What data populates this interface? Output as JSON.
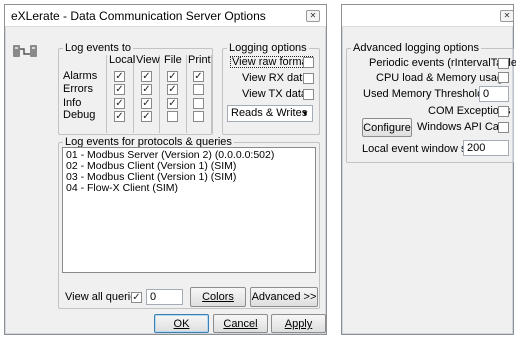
{
  "dialog": {
    "title": "eXLerate - Data Communication Server Options",
    "close_glyph": "✕"
  },
  "log_events_to": {
    "legend": "Log events to",
    "columns": [
      "Local",
      "View",
      "File",
      "Print"
    ],
    "rows": [
      {
        "label": "Alarms",
        "checks": [
          true,
          true,
          true,
          true
        ]
      },
      {
        "label": "Errors",
        "checks": [
          true,
          true,
          true,
          false
        ]
      },
      {
        "label": "Info",
        "checks": [
          true,
          true,
          true,
          false
        ]
      },
      {
        "label": "Debug",
        "checks": [
          true,
          true,
          false,
          false
        ]
      }
    ]
  },
  "logging_options": {
    "legend": "Logging options",
    "view_raw_format": {
      "label": "View raw format",
      "checked": false
    },
    "view_rx_data": {
      "label": "View RX data",
      "checked": false
    },
    "view_tx_data": {
      "label": "View TX data",
      "checked": false
    },
    "mode_select": {
      "value": "Reads & Writes"
    }
  },
  "protocols": {
    "legend": "Log events for protocols & queries",
    "items": [
      "01 - Modbus Server (Version 2) (0.0.0.0:502)",
      "02 - Modbus Client (Version 1) (SIM)",
      "03 - Modbus Client (Version 1) (SIM)",
      "04 - Flow-X Client (SIM)"
    ]
  },
  "footer": {
    "view_all_queries": {
      "label": "View all queries",
      "checked": true
    },
    "queries_value": "0",
    "colors_label": "Colors",
    "advanced_label": "Advanced >>"
  },
  "buttons": {
    "ok": "OK",
    "cancel": "Cancel",
    "apply": "Apply"
  },
  "advanced": {
    "legend": "Advanced logging options",
    "periodic_events": {
      "label": "Periodic events (rIntervalTable)",
      "checked": false
    },
    "cpu_load": {
      "label": "CPU load & Memory usage",
      "checked": false
    },
    "memory_threshold": {
      "label": "Used Memory Threshold [%]",
      "value": "0"
    },
    "com_exceptions": {
      "label": "COM Exceptions",
      "checked": false
    },
    "configure_label": "Configure",
    "windows_api_calls": {
      "label": "Windows API Calls",
      "checked": false
    },
    "local_event_window": {
      "label": "Local event window size",
      "value": "200"
    }
  }
}
